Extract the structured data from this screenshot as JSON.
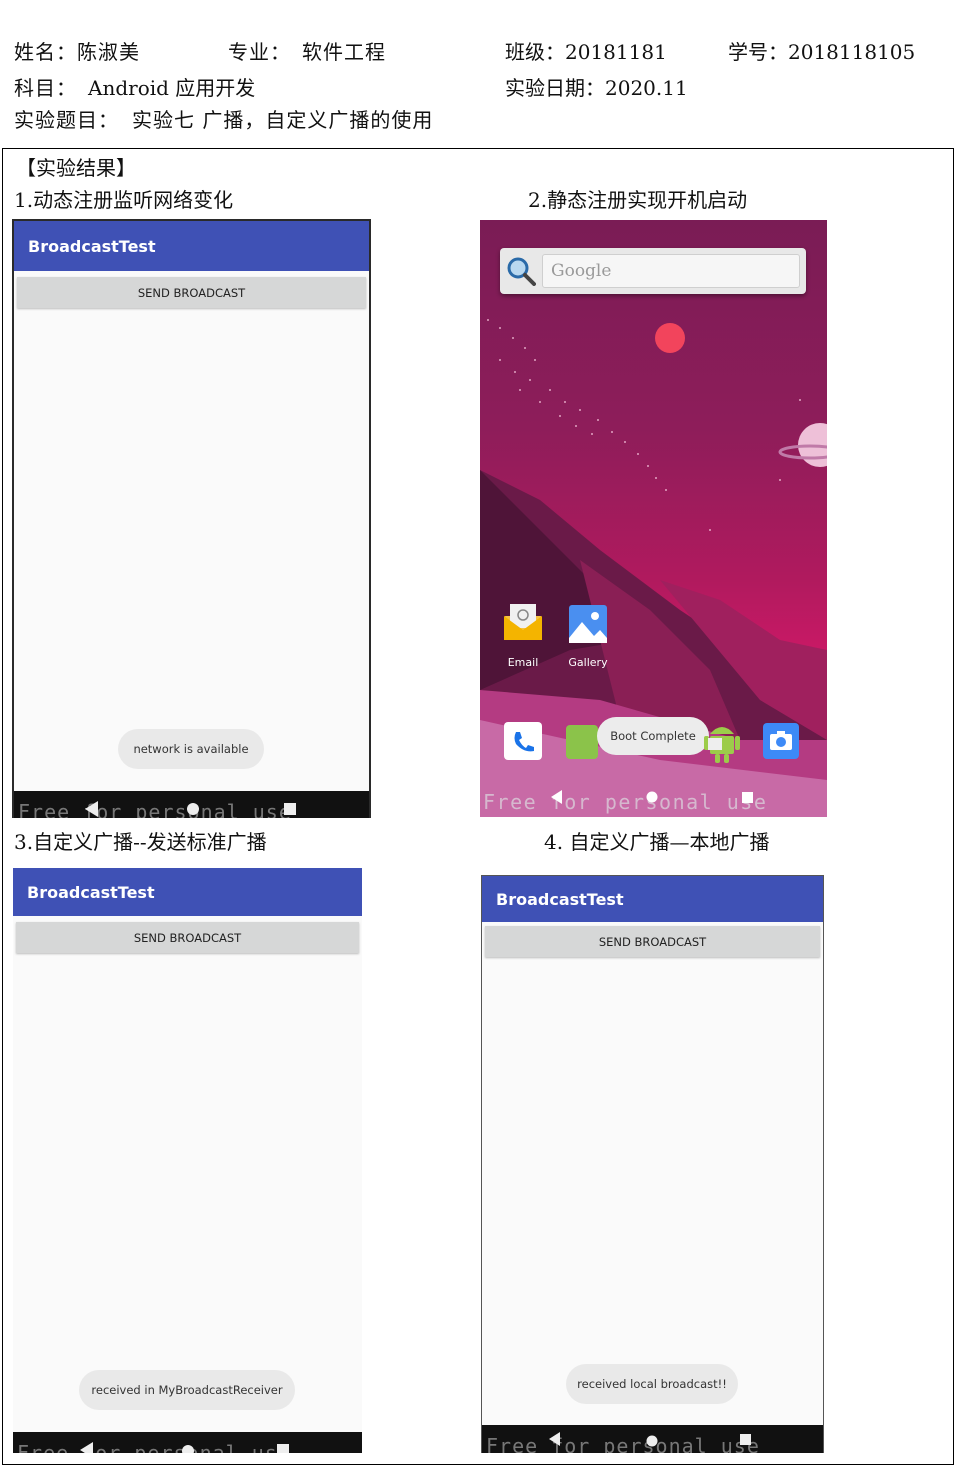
{
  "header": {
    "name": "姓名：陈淑美",
    "major_label": "专业：",
    "major": "软件工程",
    "class": "班级：20181181",
    "student_id": "学号：2018118105",
    "subject_label": "科目：",
    "subject": "Android 应用开发",
    "date": "实验日期：2020.11",
    "topic_label": "实验题目：",
    "topic": "实验七 广播，自定义广播的使用"
  },
  "section_title": "【实验结果】",
  "captions": {
    "c1": "1.动态注册监听网络变化",
    "c2": "2.静态注册实现开机启动",
    "c3": "3.自定义广播--发送标准广播",
    "c4": "4.  自定义广播—本地广播"
  },
  "screens": {
    "s1": {
      "title": "BroadcastTest",
      "button": "SEND BROADCAST",
      "toast": "network is available"
    },
    "s3": {
      "title": "BroadcastTest",
      "button": "SEND BROADCAST",
      "toast": "received in MyBroadcastReceiver"
    },
    "s4": {
      "title": "BroadcastTest",
      "button": "SEND BROADCAST",
      "toast": "received local broadcast!!"
    },
    "home": {
      "search_placeholder": "Google",
      "apps": [
        "Email",
        "Gallery"
      ],
      "toast": "Boot Complete"
    }
  },
  "watermark": "Free for personal use",
  "colors": {
    "appbar": "#3f51b5",
    "button": "#d6d7d7",
    "navbar": "#111111"
  },
  "icons": [
    "search-icon",
    "email-icon",
    "gallery-icon",
    "phone-icon",
    "messages-icon",
    "android-icon",
    "camera-icon",
    "back-icon",
    "home-icon",
    "recents-icon"
  ]
}
